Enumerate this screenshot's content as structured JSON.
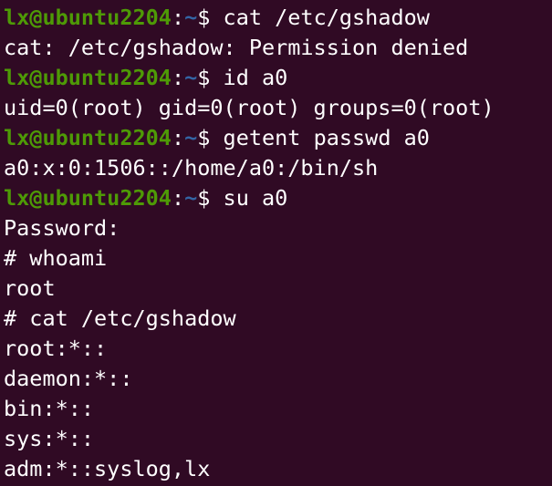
{
  "colors": {
    "background": "#300a24",
    "foreground": "#ffffff",
    "prompt_user": "#4e9a06",
    "prompt_path": "#3465a4"
  },
  "prompt": {
    "user_host": "lx@ubuntu2204",
    "separator": ":",
    "path": "~",
    "symbol": "$ "
  },
  "lines": [
    {
      "type": "command",
      "text": "cat /etc/gshadow"
    },
    {
      "type": "output",
      "text": "cat: /etc/gshadow: Permission denied"
    },
    {
      "type": "command",
      "text": "id a0"
    },
    {
      "type": "output",
      "text": "uid=0(root) gid=0(root) groups=0(root)"
    },
    {
      "type": "command",
      "text": "getent passwd a0"
    },
    {
      "type": "output",
      "text": "a0:x:0:1506::/home/a0:/bin/sh"
    },
    {
      "type": "command",
      "text": "su a0"
    },
    {
      "type": "output",
      "text": "Password:"
    },
    {
      "type": "output",
      "text": "# whoami"
    },
    {
      "type": "output",
      "text": "root"
    },
    {
      "type": "output",
      "text": "# cat /etc/gshadow"
    },
    {
      "type": "output",
      "text": "root:*::"
    },
    {
      "type": "output",
      "text": "daemon:*::"
    },
    {
      "type": "output",
      "text": "bin:*::"
    },
    {
      "type": "output",
      "text": "sys:*::"
    },
    {
      "type": "output",
      "text": "adm:*::syslog,lx"
    }
  ]
}
